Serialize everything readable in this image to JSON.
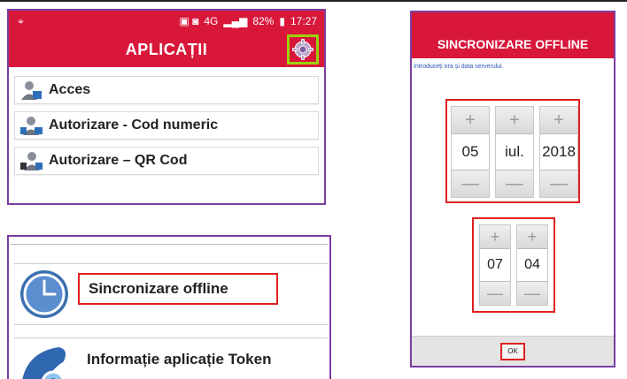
{
  "statusbar": {
    "left_icon": "location-icon",
    "battery_text": "82%",
    "time": "17:27",
    "network": "4G"
  },
  "appbar": {
    "title": "APLICAȚII",
    "settings_icon": "gear-icon"
  },
  "apps": [
    {
      "label": "Acces",
      "icon": "person-lock-icon"
    },
    {
      "label": "Autorizare - Cod numeric",
      "icon": "person-numeric-icon"
    },
    {
      "label": "Autorizare – QR Cod",
      "icon": "person-qr-icon"
    }
  ],
  "menu": {
    "sync_label": "Sincronizare offline",
    "sync_icon": "clock-icon",
    "token_label": "Informație aplicație Token",
    "token_icon": "token-key-icon"
  },
  "dialog": {
    "title": "SINCRONIZARE OFFLINE",
    "hint": "Introduceți ora și data serverului.",
    "date": {
      "day": "05",
      "month": "iul.",
      "year": "2018"
    },
    "time": {
      "hour": "07",
      "minute": "04"
    },
    "plus_symbol": "+",
    "minus_symbol": "—",
    "ok_label": "OK"
  },
  "colors": {
    "brand_red": "#d8173a",
    "highlight_red": "#e02020",
    "highlight_green": "#9ad20a",
    "frame_purple": "#7b3fa0"
  }
}
